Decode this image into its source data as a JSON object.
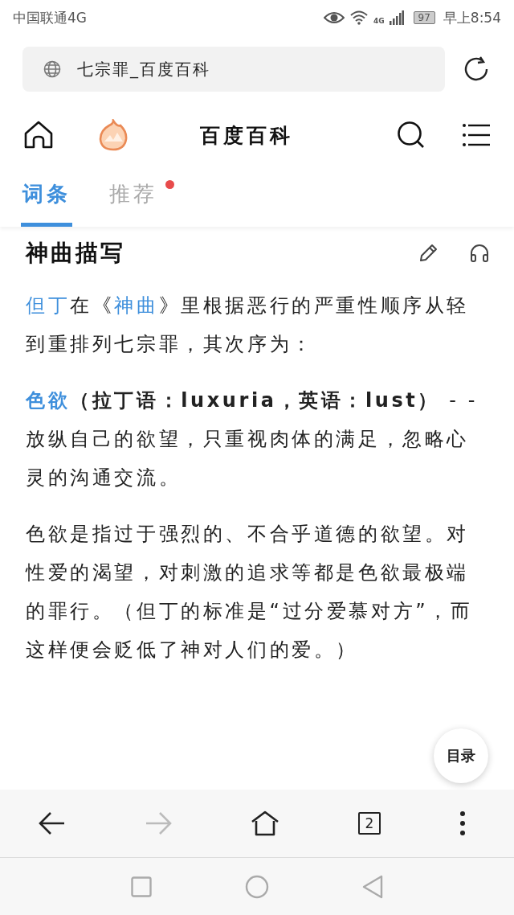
{
  "status_bar": {
    "carrier": "中国联通4G",
    "network": "4G",
    "battery": "97",
    "time": "早上8:54"
  },
  "address_bar": {
    "url": "七宗罪_百度百科"
  },
  "header": {
    "title": "百度百科"
  },
  "tabs": [
    {
      "label": "词条",
      "selected": true,
      "dot": false
    },
    {
      "label": "推荐",
      "selected": false,
      "dot": true
    }
  ],
  "section": {
    "title": "神曲描写"
  },
  "paragraphs": [
    {
      "segments": [
        {
          "text": "但丁",
          "link": true,
          "bold": false
        },
        {
          "text": "在《",
          "link": false,
          "bold": false
        },
        {
          "text": "神曲",
          "link": true,
          "bold": false
        },
        {
          "text": "》里根据恶行的严重性顺序从轻到重排列七宗罪，其次序为：",
          "link": false,
          "bold": false
        }
      ]
    },
    {
      "segments": [
        {
          "text": "色欲",
          "link": true,
          "bold": true
        },
        {
          "text": "（拉丁语：luxuria，英语：lust）",
          "link": false,
          "bold": true
        },
        {
          "text": " - - 放纵自己的欲望，只重视肉体的满足，忽略心灵的沟通交流。",
          "link": false,
          "bold": false
        }
      ]
    },
    {
      "segments": [
        {
          "text": "色欲是指过于强烈的、不合乎道德的欲望。对性爱的渴望，对刺激的追求等都是色欲最极端的罪行。（但丁的标准是“过分爱慕对方”，而这样便会贬低了神对人们的爱。）",
          "link": false,
          "bold": false
        }
      ]
    }
  ],
  "toc_button": "目录",
  "bottom_nav": {
    "tab_count": "2",
    "forward_disabled": true
  }
}
